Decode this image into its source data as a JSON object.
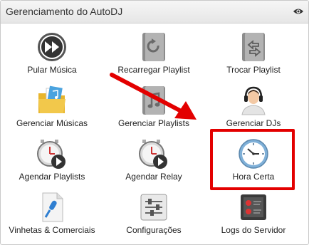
{
  "header": {
    "title": "Gerenciamento do AutoDJ",
    "toggle_icon": "eye-icon"
  },
  "tiles": [
    {
      "label": "Pular Música",
      "icon": "skip-forward-icon"
    },
    {
      "label": "Recarregar Playlist",
      "icon": "reload-playlist-icon"
    },
    {
      "label": "Trocar Playlist",
      "icon": "switch-playlist-icon"
    },
    {
      "label": "Gerenciar Músicas",
      "icon": "music-folder-icon"
    },
    {
      "label": "Gerenciar Playlists",
      "icon": "playlist-file-icon"
    },
    {
      "label": "Gerenciar DJs",
      "icon": "dj-headset-icon"
    },
    {
      "label": "Agendar Playlists",
      "icon": "schedule-playlist-icon"
    },
    {
      "label": "Agendar Relay",
      "icon": "schedule-relay-icon"
    },
    {
      "label": "Hora Certa",
      "icon": "clock-icon"
    },
    {
      "label": "Vinhetas & Comerciais",
      "icon": "microphone-file-icon"
    },
    {
      "label": "Configurações",
      "icon": "settings-sliders-icon"
    },
    {
      "label": "Logs do Servidor",
      "icon": "server-log-icon"
    }
  ],
  "colors": {
    "highlight": "#e30000",
    "arrow": "#e30000"
  }
}
